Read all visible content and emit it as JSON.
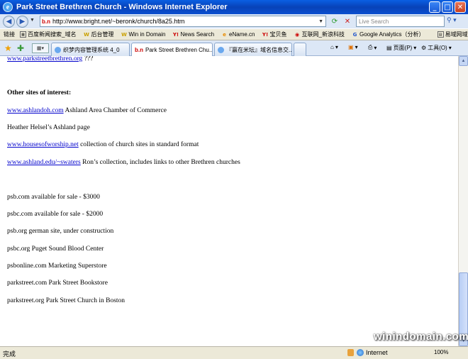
{
  "window": {
    "title": "Park Street Brethren Church - Windows Internet Explorer",
    "favicon_letter": "e",
    "controls": {
      "minimize": "_",
      "maximize": "□",
      "close": "✕"
    }
  },
  "address_bar": {
    "site_icon": "b.n",
    "url": "http://www.bright.net/~beronk/church/8a25.htm",
    "search_placeholder": "Live Search"
  },
  "links_bar": {
    "label": "链接",
    "items": [
      {
        "label": "百度新闻搜索_域名",
        "icon": "baidu-icon"
      },
      {
        "label": "后台管理",
        "icon": "w-icon"
      },
      {
        "label": "Win in Domain",
        "icon": "w-icon"
      },
      {
        "label": "News Search",
        "icon": "yahoo-icon"
      },
      {
        "label": "eName.cn",
        "icon": "ename-icon"
      },
      {
        "label": "宝贝鱼",
        "icon": "yahoo-icon"
      },
      {
        "label": "互联网_新浪科技",
        "icon": "sina-icon"
      },
      {
        "label": "Google Analytics（分析）",
        "icon": "google-icon"
      },
      {
        "label": "易域网域名论坛",
        "icon": "page-icon"
      }
    ]
  },
  "tabs": [
    {
      "label": "织梦内容管理系统 4_0",
      "active": false
    },
    {
      "label": "Park Street Brethren Chu...",
      "active": true,
      "site_icon": "b.n"
    },
    {
      "label": "『赢在米坛』域名信息交...",
      "active": false
    }
  ],
  "command_bar": {
    "page_label": "页面(P)",
    "tools_label": "工具(O)"
  },
  "content": {
    "top_link": "www.parkstreetbrethren.org",
    "top_suffix": "???",
    "heading": "Other sites of interest:",
    "links": [
      {
        "link": "www.ashlandoh.com",
        "text": "Ashland Area Chamber of Commerce"
      },
      {
        "link": "",
        "text": "Heather Helsel’s Ashland page"
      },
      {
        "link": "www.housesofworship.net",
        "text": "collection of church sites in standard format"
      },
      {
        "link": "www.ashland.edu/~swaters",
        "text": "Ron’s collection, includes links to other Brethren churches"
      }
    ],
    "domains": [
      "psb.com available for sale - $3000",
      "psbc.com available for sale - $2000",
      "psb.org german site, under construction",
      "psbc.org Puget Sound Blood Center",
      "psbonline.com Marketing Superstore",
      "parkstreet.com Park Street Bookstore",
      "parkstreet.org Park Street Church in Boston"
    ]
  },
  "status_bar": {
    "status": "完成",
    "zone": "Internet",
    "zoom": "100%"
  },
  "watermark": "winindomain.com"
}
